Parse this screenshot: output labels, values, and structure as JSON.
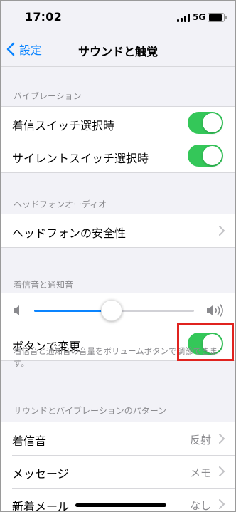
{
  "status": {
    "time": "17:02",
    "network": "5G"
  },
  "nav": {
    "back_label": "設定",
    "title": "サウンドと触覚"
  },
  "sections": {
    "vibration": {
      "header": "バイブレーション",
      "rows": [
        {
          "label": "着信スイッチ選択時",
          "on": true
        },
        {
          "label": "サイレントスイッチ選択時",
          "on": true
        }
      ]
    },
    "headphone": {
      "header": "ヘッドフォンオーディオ",
      "rows": [
        {
          "label": "ヘッドフォンの安全性"
        }
      ]
    },
    "ringer": {
      "header": "着信音と通知音",
      "volume_level": 0.48,
      "change_with_buttons": {
        "label": "ボタンで変更",
        "on": true
      },
      "footnote": "着信音と通知音の音量をボリュームボタンで調節できます。"
    },
    "patterns": {
      "header": "サウンドとバイブレーションのパターン",
      "rows": [
        {
          "label": "着信音",
          "value": "反射"
        },
        {
          "label": "メッセージ",
          "value": "メモ"
        },
        {
          "label": "新着メール",
          "value": "なし"
        }
      ]
    }
  },
  "colors": {
    "accent": "#0a84ff",
    "toggle_on": "#34c759",
    "highlight": "#e0231f"
  }
}
